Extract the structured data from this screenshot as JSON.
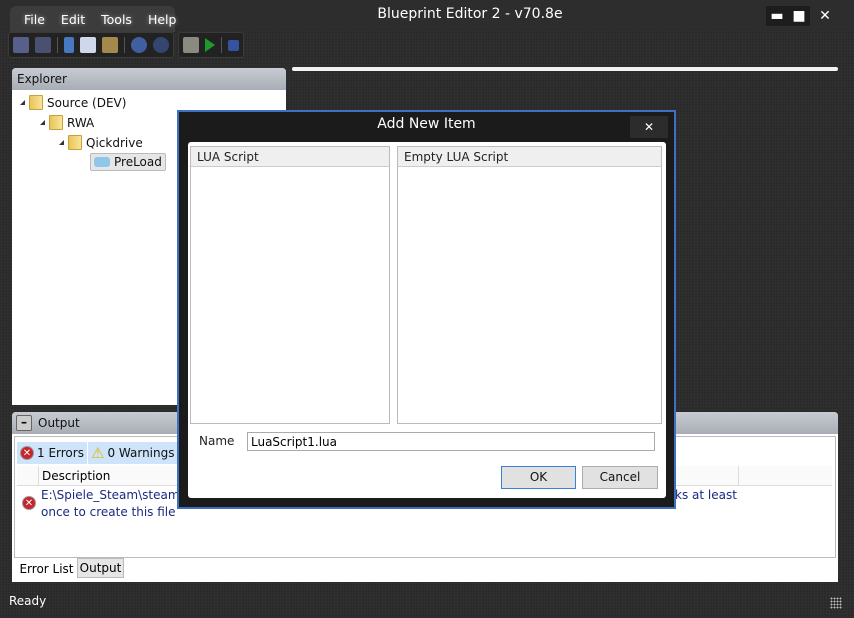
{
  "app": {
    "title": "Blueprint Editor 2 - v70.8e"
  },
  "menu": [
    "File",
    "Edit",
    "Tools",
    "Help"
  ],
  "window_buttons": {
    "minimize": "▬",
    "maximize": "■",
    "close": "✕"
  },
  "toolbar": [
    "save-icon",
    "save-all-icon",
    "cut-icon",
    "copy-icon",
    "paste-icon",
    "undo-icon",
    "redo-icon",
    "build-icon",
    "run-icon",
    "stop-icon"
  ],
  "explorer": {
    "title": "Explorer",
    "items": [
      {
        "label": "Source (DEV)",
        "level": 0
      },
      {
        "label": "RWA",
        "level": 1
      },
      {
        "label": "Qickdrive",
        "level": 2
      },
      {
        "label": "PreLoad",
        "level": 3,
        "selected": true
      }
    ]
  },
  "output": {
    "title": "Output",
    "errors": "1 Errors",
    "warnings": "0 Warnings",
    "column": "Description",
    "error_line1": "E:\\Spiele_Steam\\steam\\ste",
    "error_line1_end": "ks at least",
    "error_line2": "once to create this file",
    "tabs": [
      "Error List",
      "Output"
    ]
  },
  "status": "Ready",
  "dialog": {
    "title": "Add New Item",
    "close": "✕",
    "category_header": "LUA Script",
    "template_header": "Empty LUA Script",
    "name_label": "Name",
    "name_value": "LuaScript1.lua",
    "ok": "OK",
    "cancel": "Cancel"
  },
  "colors": {
    "accent": "#3d6fc2",
    "selection": "#cde4fa"
  }
}
